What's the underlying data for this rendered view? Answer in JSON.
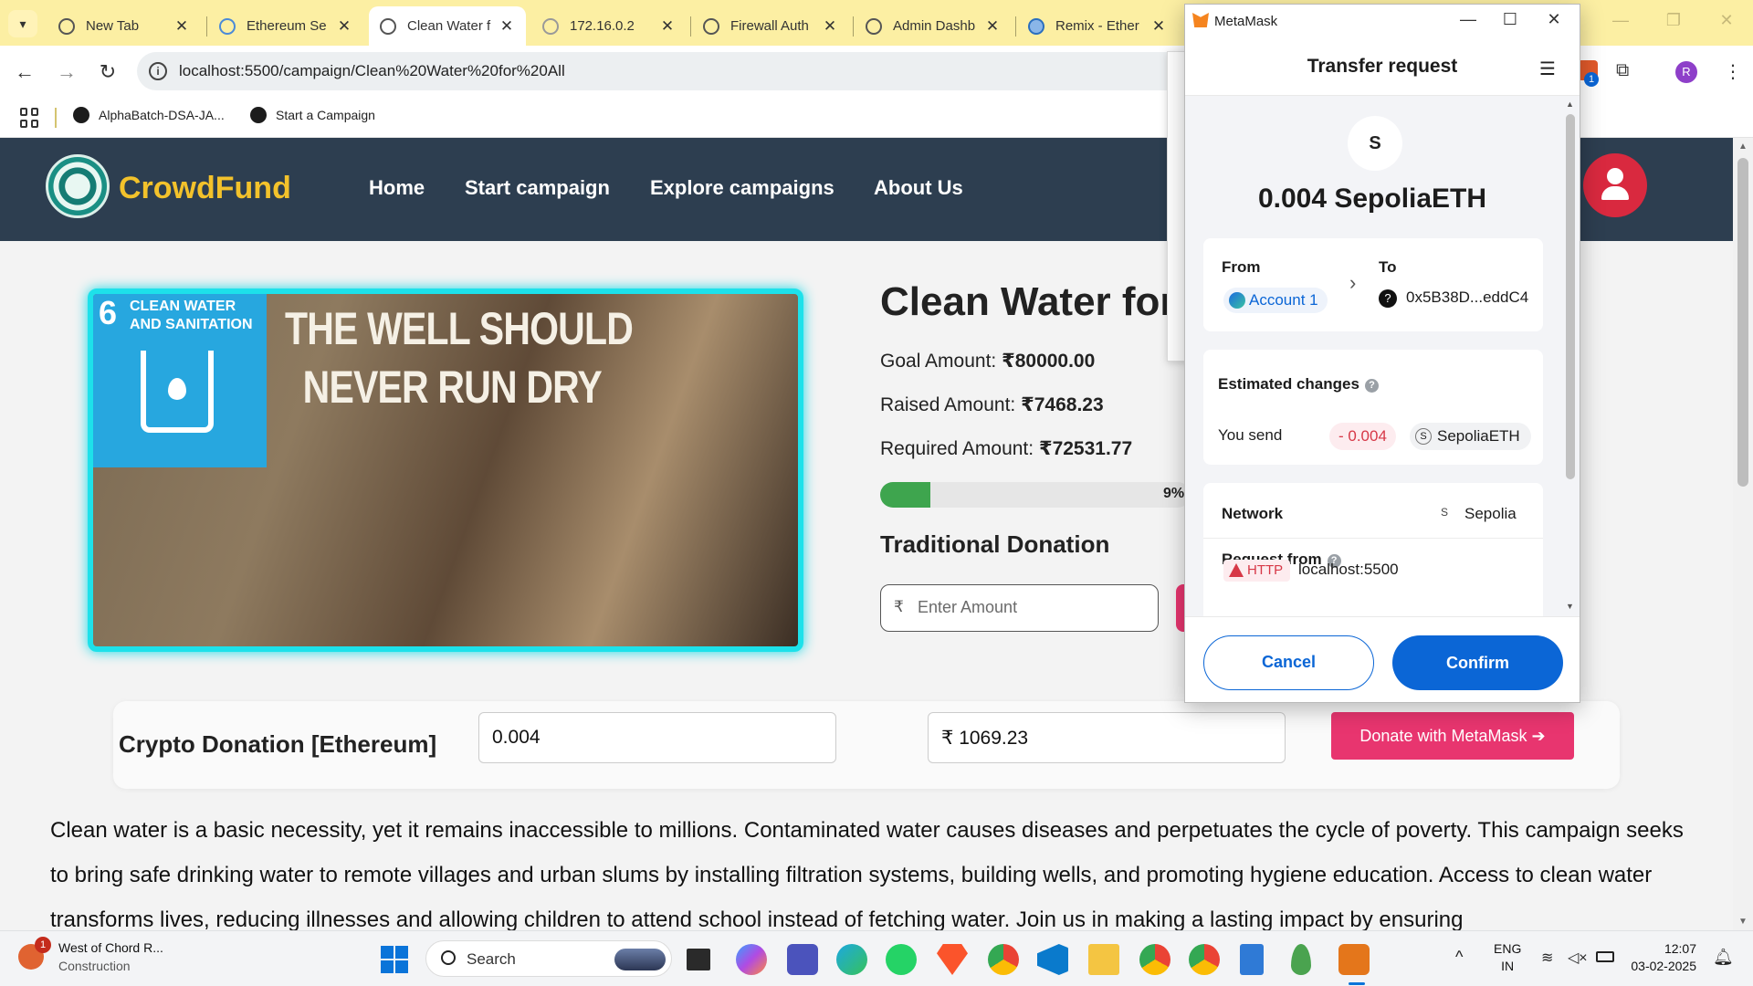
{
  "browser": {
    "tabs": [
      {
        "title": "New Tab",
        "active": false
      },
      {
        "title": "Ethereum Se",
        "active": false
      },
      {
        "title": "Clean Water f",
        "active": true
      },
      {
        "title": "172.16.0.2",
        "active": false
      },
      {
        "title": "Firewall Auth",
        "active": false
      },
      {
        "title": "Admin Dashb",
        "active": false
      },
      {
        "title": "Remix - Ether",
        "active": false
      }
    ],
    "url": "localhost:5500/campaign/Clean%20Water%20for%20All",
    "bookmarks": [
      "AlphaBatch-DSA-JA...",
      "Start a Campaign"
    ],
    "profile_initial": "R",
    "extension_badge": "1"
  },
  "site": {
    "brand": "CrowdFund",
    "nav": [
      "Home",
      "Start campaign",
      "Explore campaigns",
      "About Us"
    ],
    "campaign": {
      "image_caption_line1": "THE WELL SHOULD",
      "image_caption_line2": "NEVER RUN DRY",
      "sdg_number": "6",
      "sdg_label_line1": "CLEAN WATER",
      "sdg_label_line2": "AND SANITATION",
      "title": "Clean Water for",
      "goal_label": "Goal Amount:",
      "goal_value": "₹80000.00",
      "raised_label": "Raised Amount:",
      "raised_value": "₹7468.23",
      "required_label": "Required Amount:",
      "required_value": "₹72531.77",
      "progress_percent": 9,
      "progress_text": "9%",
      "traditional_heading": "Traditional Donation",
      "amount_currency": "₹",
      "amount_placeholder": "Enter Amount"
    },
    "crypto": {
      "label": "Crypto Donation [Ethereum]",
      "eth_value": "0.004",
      "inr_value": "₹ 1069.23",
      "button": "Donate with MetaMask ➔"
    },
    "description": "Clean water is a basic necessity, yet it remains inaccessible to millions. Contaminated water causes diseases and perpetuates the cycle of poverty. This campaign seeks to bring safe drinking water to remote villages and urban slums by installing filtration systems, building wells, and promoting hygiene education. Access to clean water transforms lives, reducing illnesses and allowing children to attend school instead of fetching water. Join us in making a lasting impact by ensuring"
  },
  "metamask": {
    "window_title": "MetaMask",
    "header": "Transfer request",
    "token_letter": "S",
    "amount": "0.004 SepoliaETH",
    "from_label": "From",
    "to_label": "To",
    "from_account": "Account 1",
    "to_address": "0x5B38D...eddC4",
    "estimated_changes": "Estimated changes",
    "you_send": "You send",
    "send_amount": "- 0.004",
    "send_token": "SepoliaETH",
    "token_glyph": "S",
    "network_label": "Network",
    "network_value": "Sepolia",
    "request_from_label": "Request from",
    "protocol_tag": "HTTP",
    "origin": "localhost:5500",
    "cancel": "Cancel",
    "confirm": "Confirm"
  },
  "taskbar": {
    "weather_line1": "West of Chord R...",
    "weather_line2": "Construction",
    "notification_count": "1",
    "search_text": "Search",
    "lang_line1": "ENG",
    "lang_line2": "IN",
    "time": "12:07",
    "date": "03-02-2025"
  },
  "colors": {
    "nav_bg": "#2d3e50",
    "brand": "#f3c22b",
    "accent_pink": "#e8356f",
    "metamask_blue": "#0b66d6",
    "tab_strip": "#fcefa3",
    "image_border": "#1de1ea",
    "progress": "#3ea54e"
  }
}
